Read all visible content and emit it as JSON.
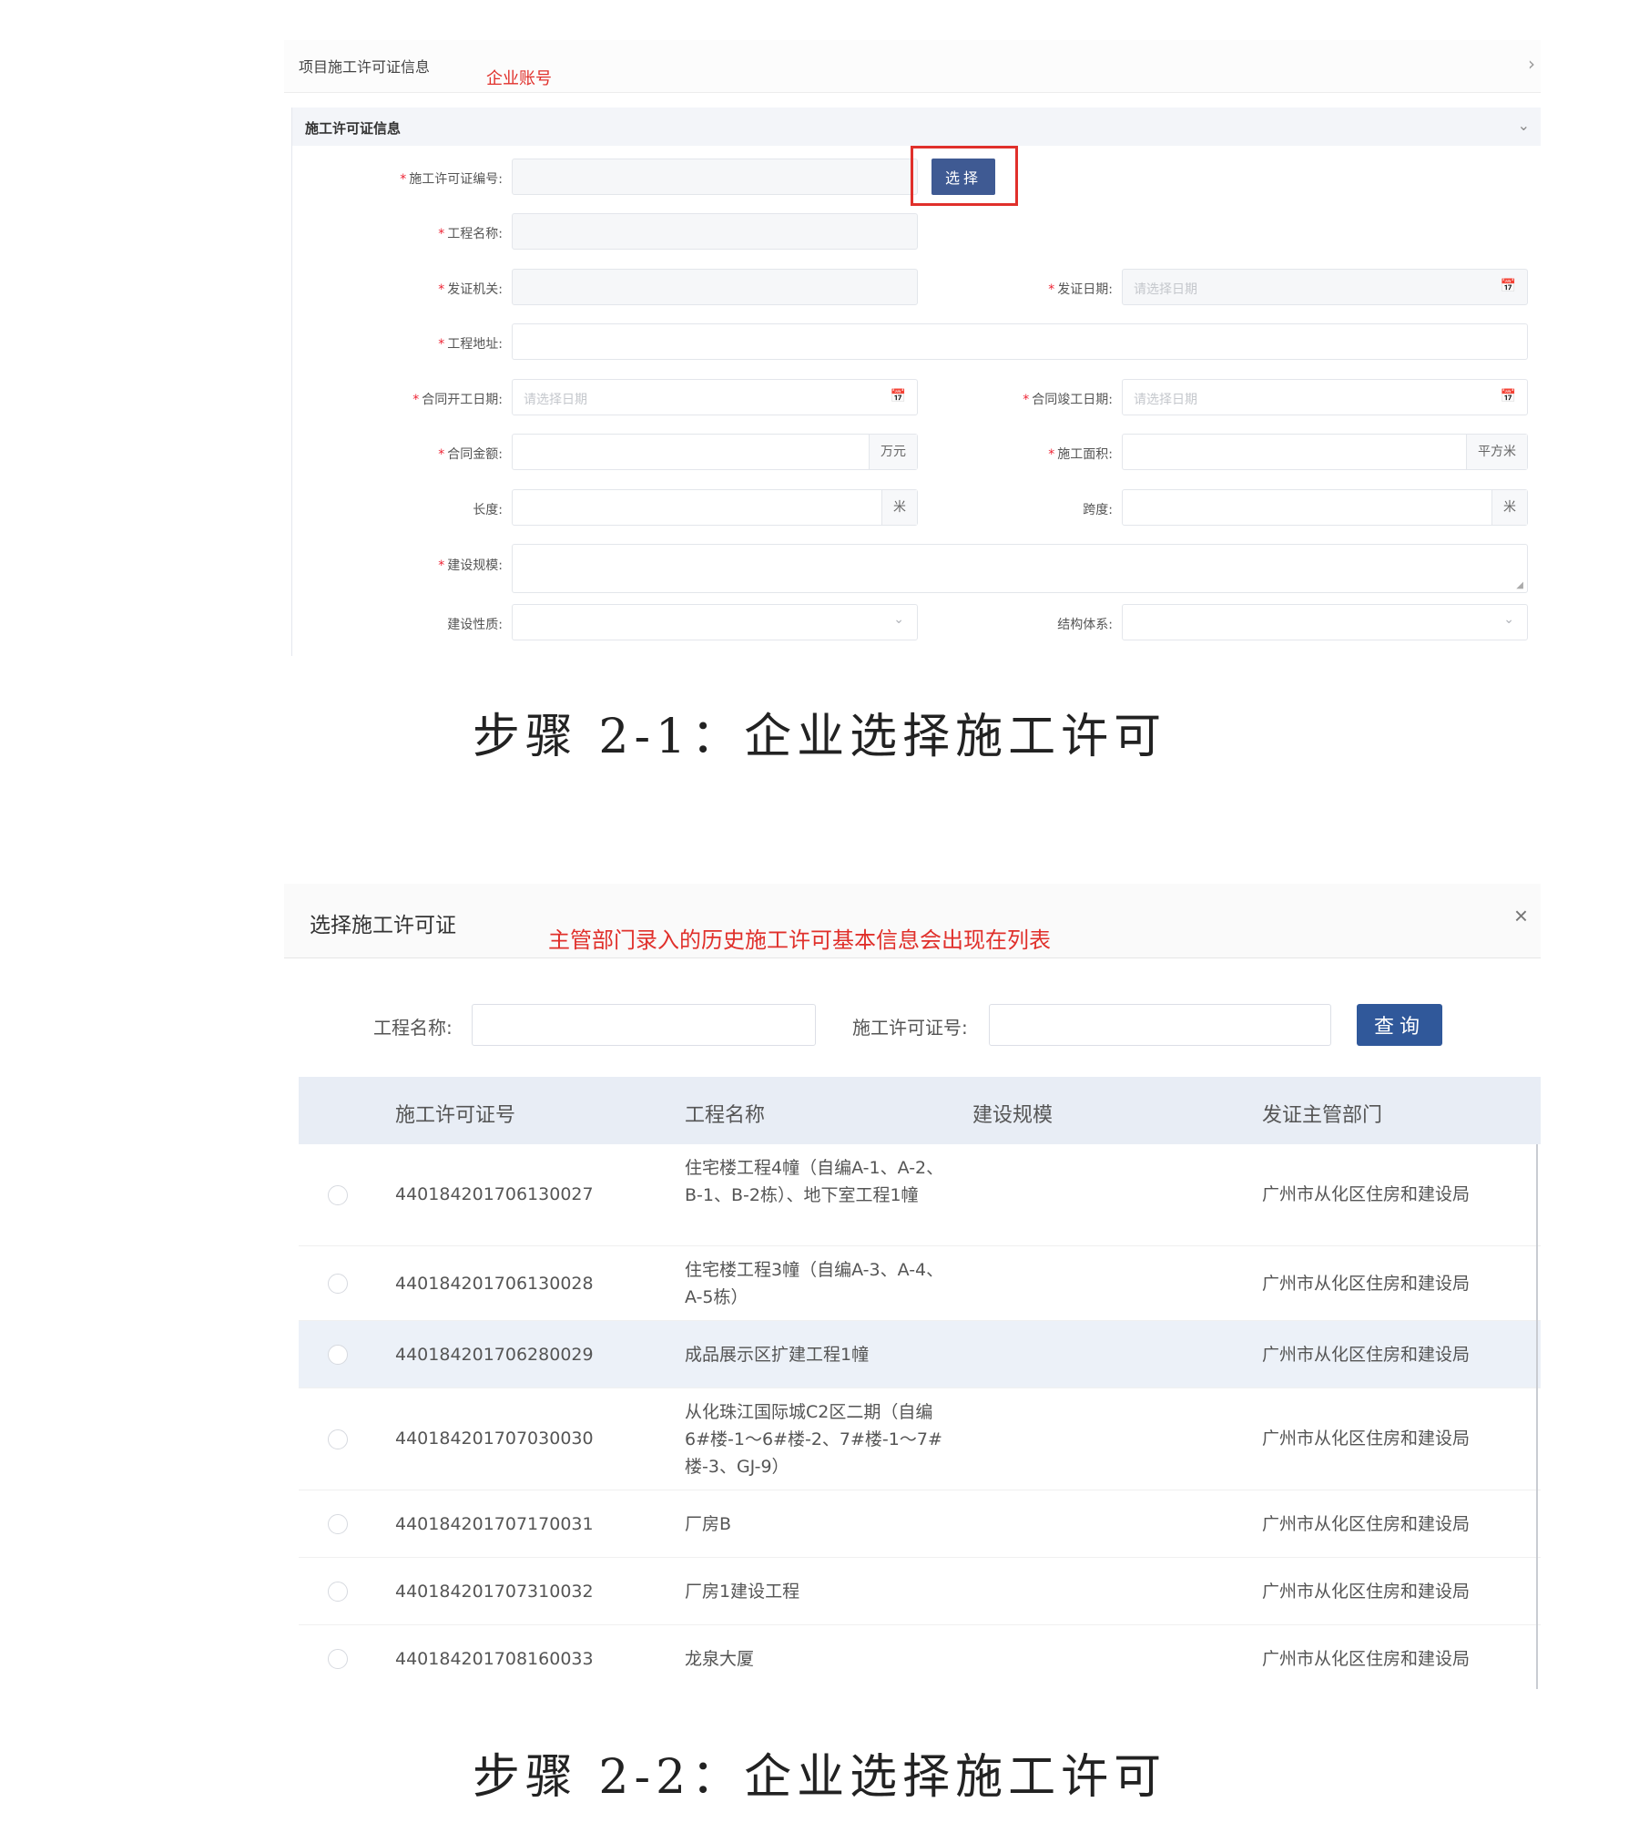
{
  "panel1": {
    "header_title": "项目施工许可证信息",
    "annotation": "企业账号",
    "header_chevron": "›",
    "section_title": "施工许可证信息",
    "section_chevron": "⌄",
    "select_button": "选择",
    "labels": {
      "permit_no": "施工许可证编号:",
      "project_name": "工程名称:",
      "issuer": "发证机关:",
      "issue_date": "发证日期:",
      "address": "工程地址:",
      "start_date": "合同开工日期:",
      "end_date": "合同竣工日期:",
      "amount": "合同金额:",
      "area": "施工面积:",
      "length": "长度:",
      "span": "跨度:",
      "scale": "建设规模:",
      "nature": "建设性质:",
      "structure": "结构体系:"
    },
    "date_placeholder": "请选择日期",
    "units": {
      "amount": "万元",
      "area": "平方米",
      "length": "米",
      "span": "米"
    }
  },
  "caption1": "步骤 2-1：企业选择施工许可",
  "panel2": {
    "title": "选择施工许可证",
    "annotation": "主管部门录入的历史施工许可基本信息会出现在列表",
    "close": "×",
    "search_name_label": "工程名称:",
    "search_no_label": "施工许可证号:",
    "search_button": "查询",
    "columns": [
      "施工许可证号",
      "工程名称",
      "建设规模",
      "发证主管部门"
    ],
    "rows": [
      {
        "no": "440184201706130027",
        "name": "住宅楼工程4幢（自编A-1、A-2、B-1、B-2栋）、地下室工程1幢",
        "scale": "",
        "dept": "广州市从化区住房和建设局"
      },
      {
        "no": "440184201706130028",
        "name": "住宅楼工程3幢（自编A-3、A-4、A-5栋）",
        "scale": "",
        "dept": "广州市从化区住房和建设局"
      },
      {
        "no": "440184201706280029",
        "name": "成品展示区扩建工程1幢",
        "scale": "",
        "dept": "广州市从化区住房和建设局"
      },
      {
        "no": "440184201707030030",
        "name": "从化珠江国际城C2区二期（自编6#楼-1～6#楼-2、7#楼-1～7#楼-3、GJ-9）",
        "scale": "",
        "dept": "广州市从化区住房和建设局"
      },
      {
        "no": "440184201707170031",
        "name": "厂房B",
        "scale": "",
        "dept": "广州市从化区住房和建设局"
      },
      {
        "no": "440184201707310032",
        "name": "厂房1建设工程",
        "scale": "",
        "dept": "广州市从化区住房和建设局"
      },
      {
        "no": "440184201708160033",
        "name": "龙泉大厦",
        "scale": "",
        "dept": "广州市从化区住房和建设局"
      }
    ]
  },
  "caption2": "步骤 2-2：企业选择施工许可",
  "icons": {
    "calendar": "📅",
    "chevron_down": "⌄"
  }
}
